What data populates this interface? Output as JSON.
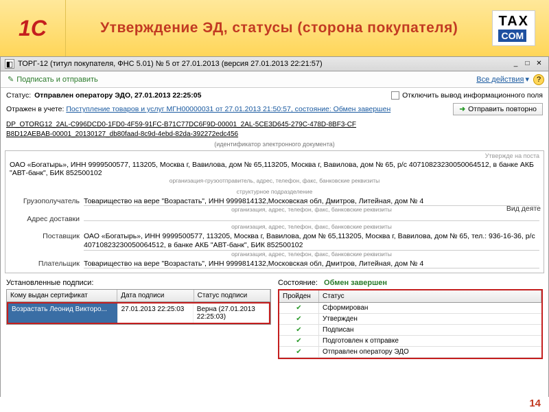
{
  "header": {
    "logo1c_text": "1С",
    "title": "Утверждение ЭД, статусы (сторона покупателя)",
    "tax_top": "TAX",
    "tax_bottom": "COM"
  },
  "window": {
    "title": "ТОРГ-12 (титул покупателя, ФНС 5.01) № 5 от 27.01.2013 (версия 27.01.2013 22:21:57)"
  },
  "toolbar": {
    "sign_send": "Подписать и отправить",
    "all_actions": "Все действия",
    "help": "?"
  },
  "status": {
    "label": "Статус:",
    "value": "Отправлен оператору ЭДО, 27.01.2013 22:25:05",
    "disable_info": "Отключить вывод информационного поля",
    "resend": "Отправить повторно"
  },
  "reflected": {
    "label": "Отражен в учете:",
    "link": "Поступление товаров и услуг МГН00000031 от 27.01.2013 21:50:57, состояние: Обмен завершен"
  },
  "docid": {
    "line1": "DP_OTORG12_2AL-C996DCD0-1FD0-4F59-91FC-B71C77DC6F9D-00001_2AL-5CE3D645-279C-478D-8BF3-CF",
    "line2": "B8D12AEBAB-00001_20130127_db80faad-8c9d-4ebd-82da-392272edc456",
    "label": "(идентификатор электронного документа)"
  },
  "panel": {
    "utv": "Утвержде на поста",
    "org_info": "ОАО «Богатырь», ИНН 9999500577, 113205, Москва г, Вавилова, дом № 65,113205, Москва г, Вавилова, дом № 65, р/с 40710823230050064512, в банке АКБ \"АВТ-банк\", БИК 852500102",
    "org_sub": "организация-грузоотправитель, адрес, телефон, факс, банковские реквизиты",
    "struct_sub": "структурное подразделение",
    "vid": "Вид деяте",
    "consignee_lbl": "Грузополучатель",
    "consignee_val": "Товарищество на вере \"Возрастать\", ИНН 9999814132,Московская обл, Дмитров, Литейная, дом № 4",
    "consignee_sub": "организация, адрес, телефон, факс, банковские реквизиты",
    "delivery_lbl": "Адрес доставки",
    "supplier_lbl": "Поставщик",
    "supplier_val": "ОАО «Богатырь», ИНН 9999500577, 113205, Москва г, Вавилова, дом № 65,113205, Москва г, Вавилова, дом № 65, тел.: 936-16-36, р/с 40710823230050064512, в банке АКБ \"АВТ-банк\", БИК 852500102",
    "supplier_sub": "организация, адрес, телефон, факс, банковские реквизиты",
    "payer_lbl": "Плательщик",
    "payer_val": "Товарищество на вере \"Возрастать\", ИНН 9999814132,Московская обл, Дмитров, Литейная, дом № 4"
  },
  "signatures": {
    "title": "Установленные подписи:",
    "columns": [
      "Кому выдан сертификат",
      "Дата подписи",
      "Статус подписи"
    ],
    "row": [
      "Возрастать Леонид Викторо...",
      "27.01.2013 22:25:03",
      "Верна (27.01.2013 22:25:03)"
    ]
  },
  "state": {
    "title": "Состояние:",
    "value": "Обмен завершен",
    "columns": [
      "Пройден",
      "Статус"
    ],
    "items": [
      {
        "passed": true,
        "status": "Сформирован"
      },
      {
        "passed": true,
        "status": "Утвержден"
      },
      {
        "passed": true,
        "status": "Подписан"
      },
      {
        "passed": true,
        "status": "Подготовлен к отправке"
      },
      {
        "passed": true,
        "status": "Отправлен оператору ЭДО"
      }
    ]
  },
  "slide_number": "14"
}
